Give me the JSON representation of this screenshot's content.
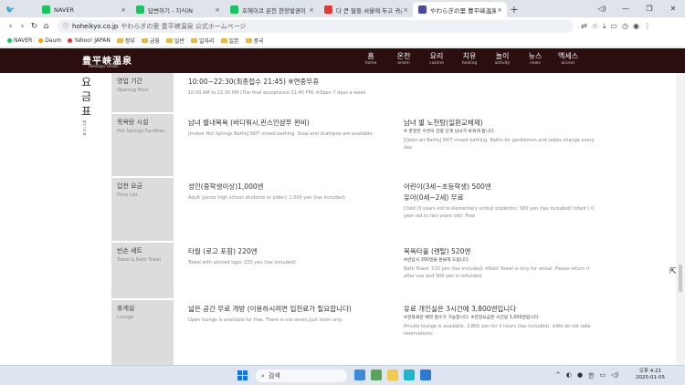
{
  "tabs": [
    {
      "label": "NAVER",
      "color": "#19c463"
    },
    {
      "label": "답변하기 - 지식iN",
      "color": "#19c463"
    },
    {
      "label": "호헤이코 온천 현장발권이 가능",
      "color": "#19c463"
    },
    {
      "label": "다 큰 딸들 서울에 두고 귀촌한",
      "color": "#e53935"
    },
    {
      "label": "やわらぎの里 豊平峡温泉 公式",
      "color": "#4a4a9a"
    }
  ],
  "address": {
    "domain": "hoheikyo.co.jp",
    "rest": "やわらぎの里 豊平峡温泉 公式ホームページ"
  },
  "bookmarks": [
    "NAVER",
    "Daum",
    "Yahoo! JAPAN",
    "정부",
    "금융",
    "일반",
    "일자리",
    "일본",
    "중국"
  ],
  "site": {
    "logo": "豊平峡温泉",
    "logo_sub": "Hoheikyo Onsen",
    "nav": [
      {
        "k": "홈",
        "e": "home"
      },
      {
        "k": "온천",
        "e": "onsen"
      },
      {
        "k": "요리",
        "e": "cuisine"
      },
      {
        "k": "치유",
        "e": "healing"
      },
      {
        "k": "놀이",
        "e": "activity"
      },
      {
        "k": "뉴스",
        "e": "news"
      },
      {
        "k": "액세스",
        "e": "access"
      }
    ],
    "vertical_title": "요금표",
    "vertical_sub": "price"
  },
  "rows": [
    {
      "lk": "영업 기간",
      "le": "Opening Hour",
      "c1k": "10:00~22:30(최종접수 21:45) ※연중무휴",
      "c1e": "10:00 AM to 22:30 PM (The final acceptance 21:45 PM) ※Open 7 days a week",
      "c2k": "",
      "c2s": "",
      "c2e": ""
    },
    {
      "lk": "목욕탕 시설",
      "le": "Hot Springs Facilities",
      "c1k": "남녀 별내목욕 (바디워시,린스인샴푸 완비)",
      "c1e": "[Indoor Hot Springs Baths] NOT mixed bathing. Soap and shampoo are available.",
      "c2k": "남녀 별 노천탕(일환교체제)",
      "c2s": "※ 온천은 수연의 관광 단계 남녀가 바뀌게 됩니다.",
      "c2e": "[Open-air Baths] NOT mixed bathing. Baths for gentlemen and ladies change every day."
    },
    {
      "lk": "입천 요금",
      "le": "Price List",
      "c1k": "성인(중학생이상)1,000엔",
      "c1e": "Adult (junior high school students or older): 1,000 yen (tax included)",
      "c2k": "어린이(3세~초등학생) 500엔",
      "c2k2": "유아(0세~2세) 무료",
      "c2s": "",
      "c2e": "Child (3 years old to elementary school students): 500 yen (tax included) Infant ( 0 year old to two years old): Free"
    },
    {
      "lk": "빈손 세트",
      "le": "Towel & Bath Towel",
      "c1k": "타월 (로고 포함) 220엔",
      "c1e": "Towel with printed logo: 220 yen (tax included)",
      "c2k": "목욕타올 (렌탈) 520엔",
      "c2s": "※반납시 300엔을 환불해 드립니다.",
      "c2e": "Bath Towel: 520 yen (tax included) ※Bath Towel is only for rental. Please return it after use and 300 yen is refunded."
    },
    {
      "lk": "휴게실",
      "le": "Lounge",
      "c1k": "넓은 공간 무료 개방 (이용하시려면 입천료가 필요합니다)",
      "c1e": "Open lounge is available for free. There is not onsen,just room only.",
      "c2k": "유료 개인실은 3시간에 3,800엔입니다",
      "c2s": "※전화로만 예약 접수가 가능합니다. ※연장요금은 시간당 1,000엔입니다.",
      "c2e": "Private lounge is available. 3,800 yen for 3 hours (tax included). ※We do not take reservations."
    }
  ],
  "taskbar": {
    "search": "검색",
    "lang": "한",
    "time": "오후 4:21",
    "date": "2025-01-05"
  }
}
